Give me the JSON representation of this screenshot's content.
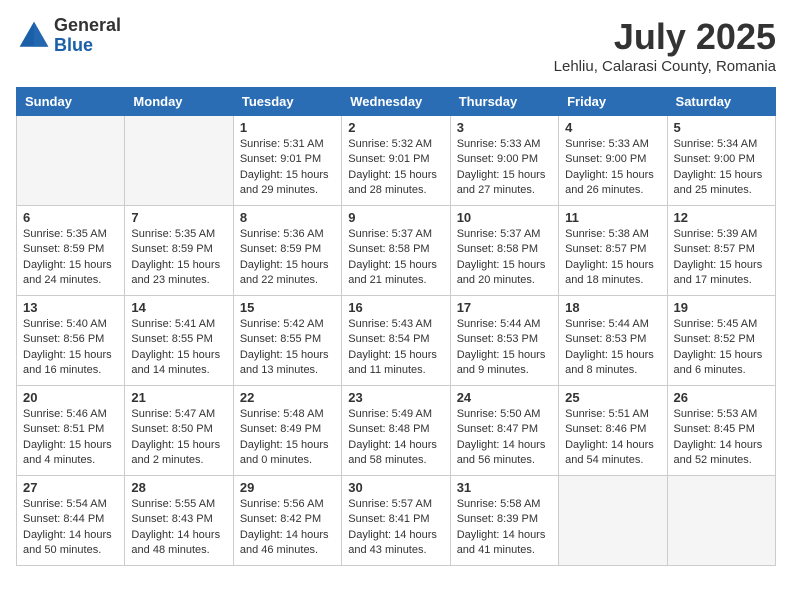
{
  "header": {
    "logo_general": "General",
    "logo_blue": "Blue",
    "month_year": "July 2025",
    "location": "Lehliu, Calarasi County, Romania"
  },
  "days_of_week": [
    "Sunday",
    "Monday",
    "Tuesday",
    "Wednesday",
    "Thursday",
    "Friday",
    "Saturday"
  ],
  "weeks": [
    [
      {
        "day": "",
        "info": ""
      },
      {
        "day": "",
        "info": ""
      },
      {
        "day": "1",
        "info": "Sunrise: 5:31 AM\nSunset: 9:01 PM\nDaylight: 15 hours\nand 29 minutes."
      },
      {
        "day": "2",
        "info": "Sunrise: 5:32 AM\nSunset: 9:01 PM\nDaylight: 15 hours\nand 28 minutes."
      },
      {
        "day": "3",
        "info": "Sunrise: 5:33 AM\nSunset: 9:00 PM\nDaylight: 15 hours\nand 27 minutes."
      },
      {
        "day": "4",
        "info": "Sunrise: 5:33 AM\nSunset: 9:00 PM\nDaylight: 15 hours\nand 26 minutes."
      },
      {
        "day": "5",
        "info": "Sunrise: 5:34 AM\nSunset: 9:00 PM\nDaylight: 15 hours\nand 25 minutes."
      }
    ],
    [
      {
        "day": "6",
        "info": "Sunrise: 5:35 AM\nSunset: 8:59 PM\nDaylight: 15 hours\nand 24 minutes."
      },
      {
        "day": "7",
        "info": "Sunrise: 5:35 AM\nSunset: 8:59 PM\nDaylight: 15 hours\nand 23 minutes."
      },
      {
        "day": "8",
        "info": "Sunrise: 5:36 AM\nSunset: 8:59 PM\nDaylight: 15 hours\nand 22 minutes."
      },
      {
        "day": "9",
        "info": "Sunrise: 5:37 AM\nSunset: 8:58 PM\nDaylight: 15 hours\nand 21 minutes."
      },
      {
        "day": "10",
        "info": "Sunrise: 5:37 AM\nSunset: 8:58 PM\nDaylight: 15 hours\nand 20 minutes."
      },
      {
        "day": "11",
        "info": "Sunrise: 5:38 AM\nSunset: 8:57 PM\nDaylight: 15 hours\nand 18 minutes."
      },
      {
        "day": "12",
        "info": "Sunrise: 5:39 AM\nSunset: 8:57 PM\nDaylight: 15 hours\nand 17 minutes."
      }
    ],
    [
      {
        "day": "13",
        "info": "Sunrise: 5:40 AM\nSunset: 8:56 PM\nDaylight: 15 hours\nand 16 minutes."
      },
      {
        "day": "14",
        "info": "Sunrise: 5:41 AM\nSunset: 8:55 PM\nDaylight: 15 hours\nand 14 minutes."
      },
      {
        "day": "15",
        "info": "Sunrise: 5:42 AM\nSunset: 8:55 PM\nDaylight: 15 hours\nand 13 minutes."
      },
      {
        "day": "16",
        "info": "Sunrise: 5:43 AM\nSunset: 8:54 PM\nDaylight: 15 hours\nand 11 minutes."
      },
      {
        "day": "17",
        "info": "Sunrise: 5:44 AM\nSunset: 8:53 PM\nDaylight: 15 hours\nand 9 minutes."
      },
      {
        "day": "18",
        "info": "Sunrise: 5:44 AM\nSunset: 8:53 PM\nDaylight: 15 hours\nand 8 minutes."
      },
      {
        "day": "19",
        "info": "Sunrise: 5:45 AM\nSunset: 8:52 PM\nDaylight: 15 hours\nand 6 minutes."
      }
    ],
    [
      {
        "day": "20",
        "info": "Sunrise: 5:46 AM\nSunset: 8:51 PM\nDaylight: 15 hours\nand 4 minutes."
      },
      {
        "day": "21",
        "info": "Sunrise: 5:47 AM\nSunset: 8:50 PM\nDaylight: 15 hours\nand 2 minutes."
      },
      {
        "day": "22",
        "info": "Sunrise: 5:48 AM\nSunset: 8:49 PM\nDaylight: 15 hours\nand 0 minutes."
      },
      {
        "day": "23",
        "info": "Sunrise: 5:49 AM\nSunset: 8:48 PM\nDaylight: 14 hours\nand 58 minutes."
      },
      {
        "day": "24",
        "info": "Sunrise: 5:50 AM\nSunset: 8:47 PM\nDaylight: 14 hours\nand 56 minutes."
      },
      {
        "day": "25",
        "info": "Sunrise: 5:51 AM\nSunset: 8:46 PM\nDaylight: 14 hours\nand 54 minutes."
      },
      {
        "day": "26",
        "info": "Sunrise: 5:53 AM\nSunset: 8:45 PM\nDaylight: 14 hours\nand 52 minutes."
      }
    ],
    [
      {
        "day": "27",
        "info": "Sunrise: 5:54 AM\nSunset: 8:44 PM\nDaylight: 14 hours\nand 50 minutes."
      },
      {
        "day": "28",
        "info": "Sunrise: 5:55 AM\nSunset: 8:43 PM\nDaylight: 14 hours\nand 48 minutes."
      },
      {
        "day": "29",
        "info": "Sunrise: 5:56 AM\nSunset: 8:42 PM\nDaylight: 14 hours\nand 46 minutes."
      },
      {
        "day": "30",
        "info": "Sunrise: 5:57 AM\nSunset: 8:41 PM\nDaylight: 14 hours\nand 43 minutes."
      },
      {
        "day": "31",
        "info": "Sunrise: 5:58 AM\nSunset: 8:39 PM\nDaylight: 14 hours\nand 41 minutes."
      },
      {
        "day": "",
        "info": ""
      },
      {
        "day": "",
        "info": ""
      }
    ]
  ]
}
